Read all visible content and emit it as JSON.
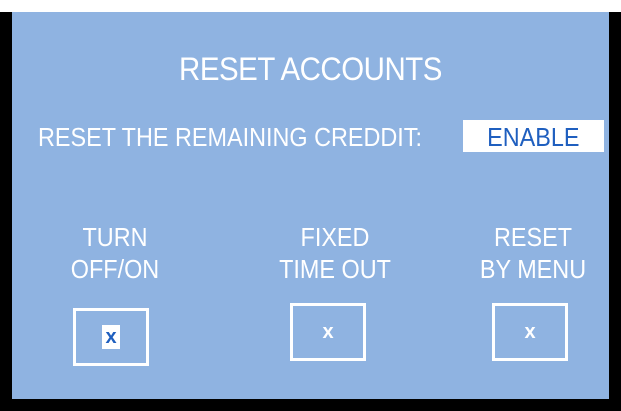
{
  "screen": {
    "title": "RESET ACCOUNTS",
    "setting": {
      "label": "RESET THE REMAINING CREDDIT:",
      "value": "ENABLE"
    },
    "options": [
      {
        "line1": "TURN",
        "line2": "OFF/ON",
        "mark": "x",
        "selected": true
      },
      {
        "line1": "FIXED",
        "line2": "TIME OUT",
        "mark": "x",
        "selected": false
      },
      {
        "line1": "RESET",
        "line2": "BY MENU",
        "mark": "x",
        "selected": false
      }
    ]
  },
  "colors": {
    "panel_background": "#8fb3e1",
    "frame": "#000000",
    "text": "#ffffff",
    "highlight_text": "#1f5fbf"
  }
}
